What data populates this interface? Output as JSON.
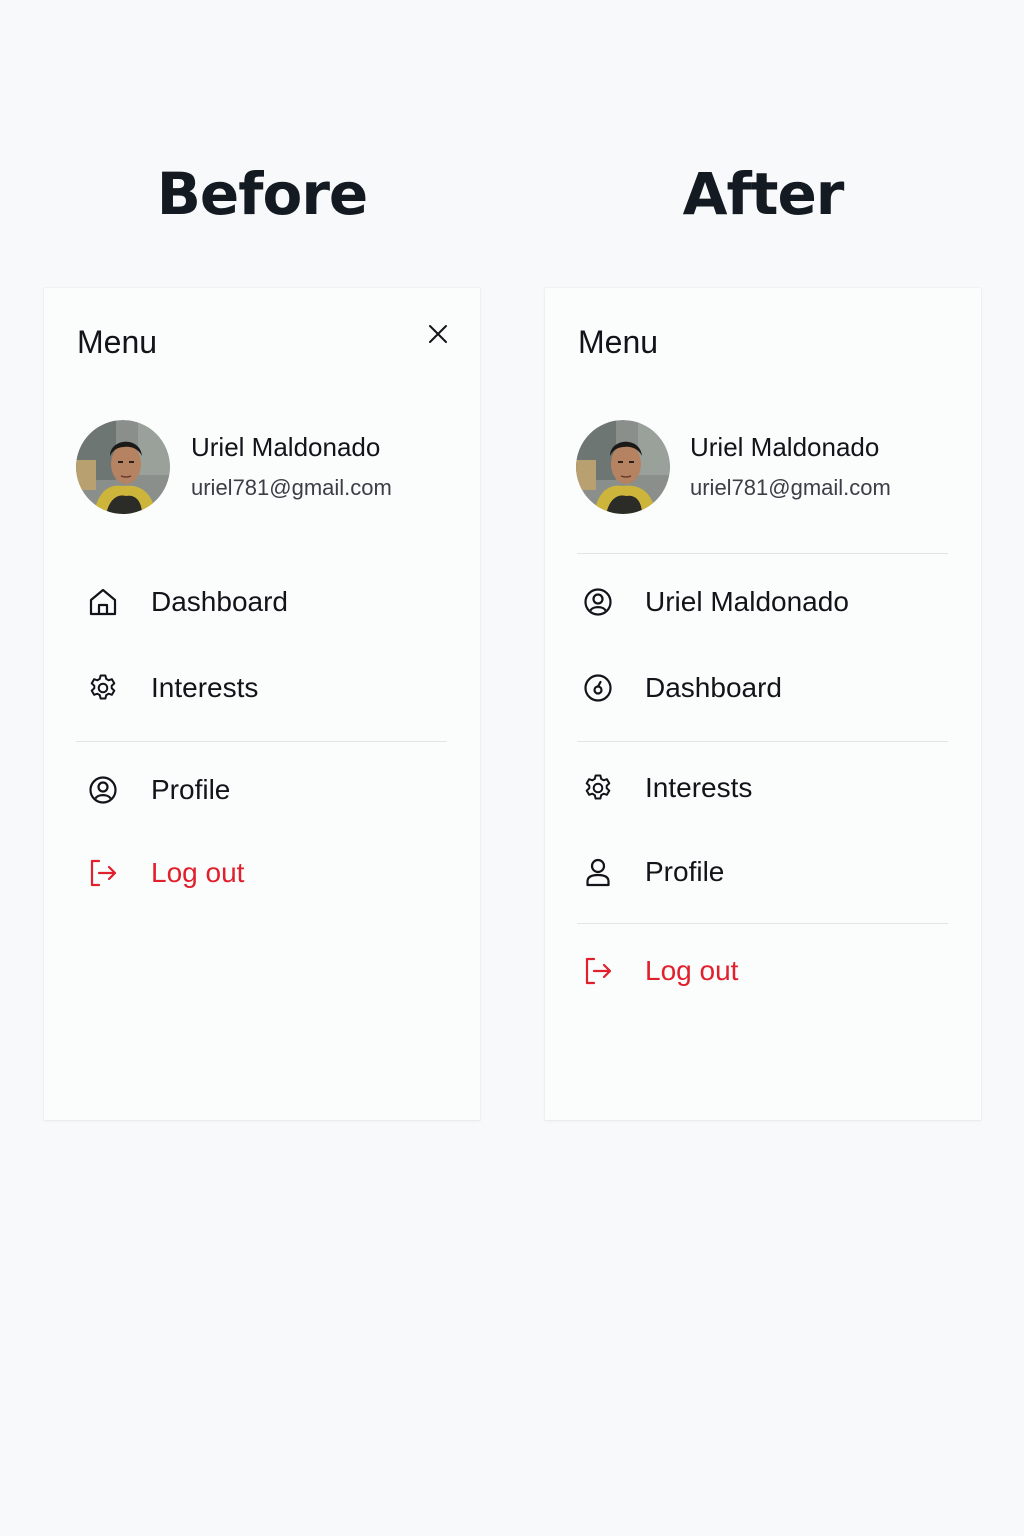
{
  "columns": {
    "before_title": "Before",
    "after_title": "After"
  },
  "before": {
    "menu_title": "Menu",
    "user": {
      "name": "Uriel Maldonado",
      "email": "uriel781@gmail.com"
    },
    "items": [
      {
        "label": "Dashboard",
        "icon": "home-icon"
      },
      {
        "label": "Interests",
        "icon": "gear-icon"
      },
      {
        "label": "Profile",
        "icon": "user-circle-icon"
      },
      {
        "label": "Log out",
        "icon": "logout-icon"
      }
    ]
  },
  "after": {
    "menu_title": "Menu",
    "user": {
      "name": "Uriel Maldonado",
      "email": "uriel781@gmail.com"
    },
    "items": [
      {
        "label": "Uriel Maldonado",
        "icon": "user-circle-icon"
      },
      {
        "label": "Dashboard",
        "icon": "gauge-icon"
      },
      {
        "label": "Interests",
        "icon": "gear-icon"
      },
      {
        "label": "Profile",
        "icon": "user-icon"
      },
      {
        "label": "Log out",
        "icon": "logout-icon"
      }
    ]
  },
  "colors": {
    "background": "#f7f9fa",
    "panel": "#fbfdfd",
    "text": "#111418",
    "danger": "#e0202c",
    "divider": "#e1e5e8"
  }
}
